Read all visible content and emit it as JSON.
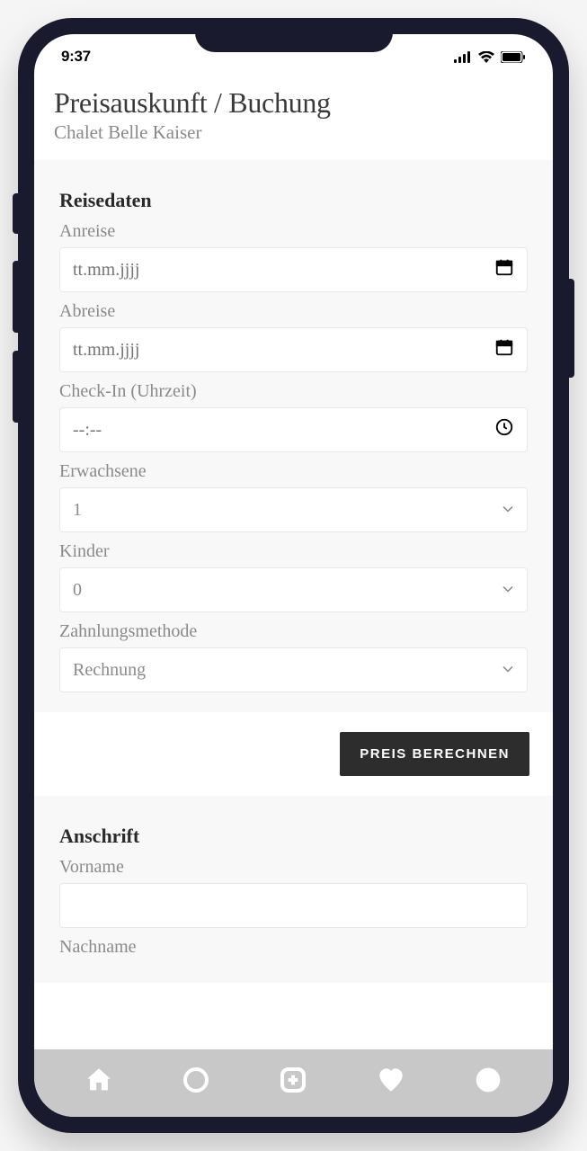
{
  "status": {
    "time": "9:37"
  },
  "header": {
    "title": "Preisauskunft / Buchung",
    "subtitle": "Chalet Belle Kaiser"
  },
  "sections": {
    "travel": {
      "heading": "Reisedaten",
      "arrival_label": "Anreise",
      "arrival_placeholder": "tt.mm.jjjj",
      "departure_label": "Abreise",
      "departure_placeholder": "tt.mm.jjjj",
      "checkin_label": "Check-In (Uhrzeit)",
      "checkin_placeholder": "--:--",
      "adults_label": "Erwachsene",
      "adults_value": "1",
      "children_label": "Kinder",
      "children_value": "0",
      "payment_label": "Zahnlungsmethode",
      "payment_value": "Rechnung"
    },
    "address": {
      "heading": "Anschrift",
      "firstname_label": "Vorname",
      "lastname_label": "Nachname"
    }
  },
  "actions": {
    "calculate_label": "PREIS BERECHNEN"
  }
}
